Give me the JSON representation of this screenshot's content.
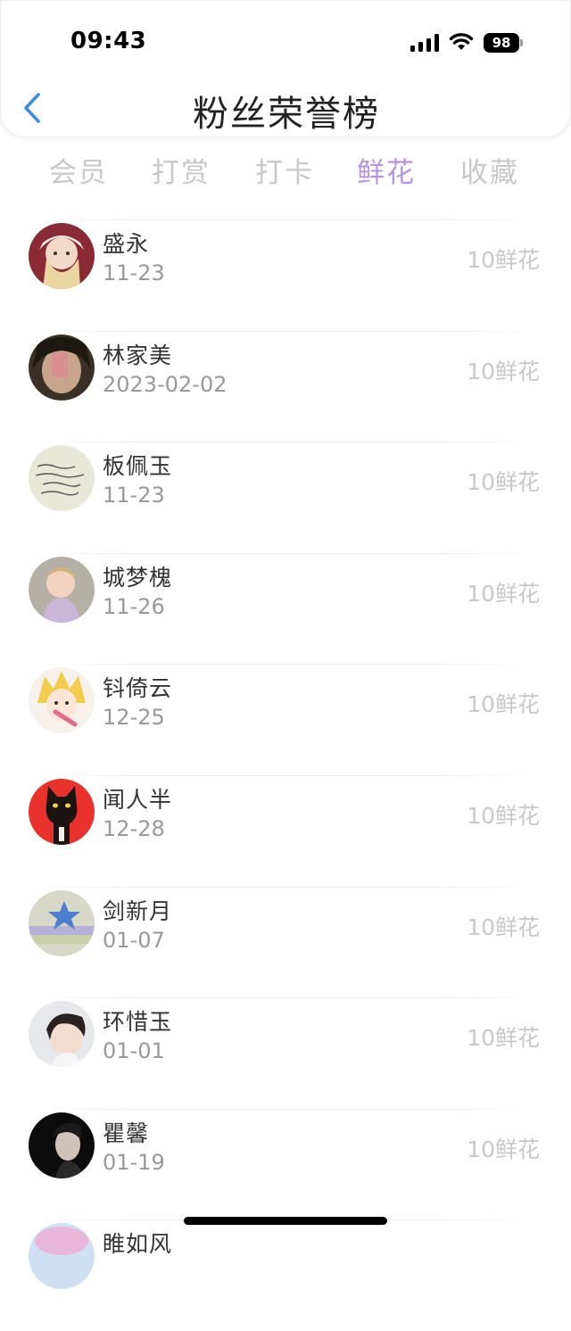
{
  "status_bar": {
    "time": "09:43",
    "battery": "98"
  },
  "header": {
    "title": "粉丝荣誉榜",
    "back_icon": "chevron-left-icon"
  },
  "tabs": [
    {
      "label": "会员",
      "active": false
    },
    {
      "label": "打赏",
      "active": false
    },
    {
      "label": "打卡",
      "active": false
    },
    {
      "label": "鲜花",
      "active": true
    },
    {
      "label": "收藏",
      "active": false
    }
  ],
  "colors": {
    "accent": "#b893dd",
    "back_arrow": "#3a8fe0",
    "muted": "#c8c8c8"
  },
  "fans": [
    {
      "name": "盛永",
      "date": "11-23",
      "amount": "10鲜花"
    },
    {
      "name": "林家美",
      "date": "2023-02-02",
      "amount": "10鲜花"
    },
    {
      "name": "板佩玉",
      "date": "11-23",
      "amount": "10鲜花"
    },
    {
      "name": "城梦槐",
      "date": "11-26",
      "amount": "10鲜花"
    },
    {
      "name": "钭倚云",
      "date": "12-25",
      "amount": "10鲜花"
    },
    {
      "name": "闻人半",
      "date": "12-28",
      "amount": "10鲜花"
    },
    {
      "name": "剑新月",
      "date": "01-07",
      "amount": "10鲜花"
    },
    {
      "name": "环惜玉",
      "date": "01-01",
      "amount": "10鲜花"
    },
    {
      "name": "瞿馨",
      "date": "01-19",
      "amount": "10鲜花"
    },
    {
      "name": "睢如风",
      "date": "",
      "amount": ""
    }
  ]
}
